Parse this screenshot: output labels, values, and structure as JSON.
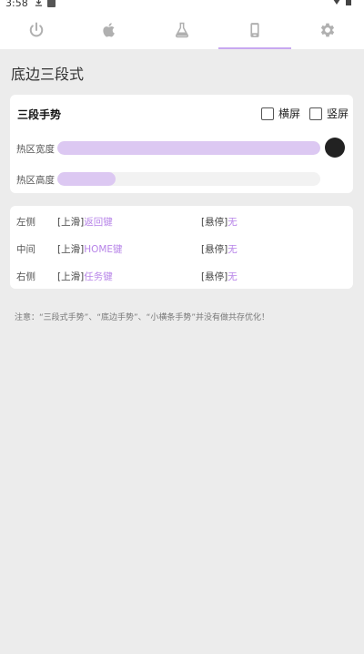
{
  "status_bar": {
    "time": "3:58"
  },
  "tabs": [
    {
      "icon": "power-icon",
      "active": false
    },
    {
      "icon": "apple-icon",
      "active": false
    },
    {
      "icon": "flask-icon",
      "active": false
    },
    {
      "icon": "phone-icon",
      "active": true
    },
    {
      "icon": "gear-icon",
      "active": false
    }
  ],
  "page": {
    "title": "底边三段式"
  },
  "gesture_card": {
    "title": "三段手势",
    "landscape_label": "横屏",
    "portrait_label": "竖屏",
    "landscape_checked": false,
    "portrait_checked": false,
    "hotzone_width_label": "热区宽度",
    "hotzone_width_value": 1.0,
    "hotzone_height_label": "热区高度",
    "hotzone_height_value": 0.22
  },
  "actions": [
    {
      "position": "左侧",
      "swipe_label": "[上滑]",
      "swipe_action": "返回键",
      "hover_label": "[悬停]",
      "hover_action": "无"
    },
    {
      "position": "中间",
      "swipe_label": "[上滑]",
      "swipe_action": "HOME键",
      "hover_label": "[悬停]",
      "hover_action": "无"
    },
    {
      "position": "右侧",
      "swipe_label": "[上滑]",
      "swipe_action": "任务键",
      "hover_label": "[悬停]",
      "hover_action": "无"
    }
  ],
  "note": "注意：“三段式手势”、“底边手势”、“小横条手势”并没有做共存优化！",
  "colors": {
    "accent": "#b784e8",
    "slider_fill": "#dcc8f2",
    "tab_indicator": "#c8a8f0",
    "icon_gray": "#b0b0b0"
  }
}
